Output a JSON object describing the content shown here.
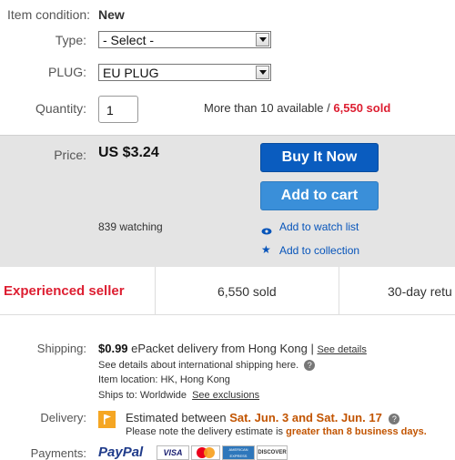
{
  "item": {
    "condition_label": "Item condition:",
    "condition_value": "New"
  },
  "type_field": {
    "label": "Type:",
    "selected": "- Select -"
  },
  "plug_field": {
    "label": "PLUG:",
    "selected": "EU PLUG"
  },
  "quantity": {
    "label": "Quantity:",
    "value": "1",
    "availability": "More than 10 available /",
    "sold": "6,550 sold"
  },
  "price_box": {
    "label": "Price:",
    "price": "US $3.24",
    "buy_now": "Buy It Now",
    "add_to_cart": "Add to cart",
    "watching": "839 watching",
    "watch_list": "Add to watch list",
    "collection": "Add to collection"
  },
  "badges": {
    "experienced": "Experienced seller",
    "sold": "6,550 sold",
    "returns": "30-day retu"
  },
  "shipping": {
    "label": "Shipping:",
    "price": "$0.99",
    "method": "ePacket delivery from Hong Kong |",
    "see_details": "See details",
    "international": "See details about international shipping here.",
    "item_location_label": "Item location:",
    "item_location": "HK, Hong Kong",
    "ships_to_label": "Ships to:",
    "ships_to": "Worldwide",
    "see_exclusions": "See exclusions"
  },
  "delivery": {
    "label": "Delivery:",
    "estimated_prefix": "Estimated between",
    "dates": "Sat. Jun. 3 and Sat. Jun. 17",
    "note_prefix": "Please note the delivery estimate is",
    "note_highlight": "greater than 8 business days."
  },
  "payments": {
    "label": "Payments:",
    "paypal": "PayPal",
    "cards": [
      "VISA",
      "",
      "AMERICAN EXPRESS",
      "DISCOVER"
    ]
  },
  "colors": {
    "sold_red": "#dd1e31",
    "buy_blue": "#0a5cbf",
    "cart_blue": "#3a8fd9",
    "link_blue": "#0654ba",
    "orange_date": "#c25400",
    "price_bg": "#e4e4e4"
  }
}
